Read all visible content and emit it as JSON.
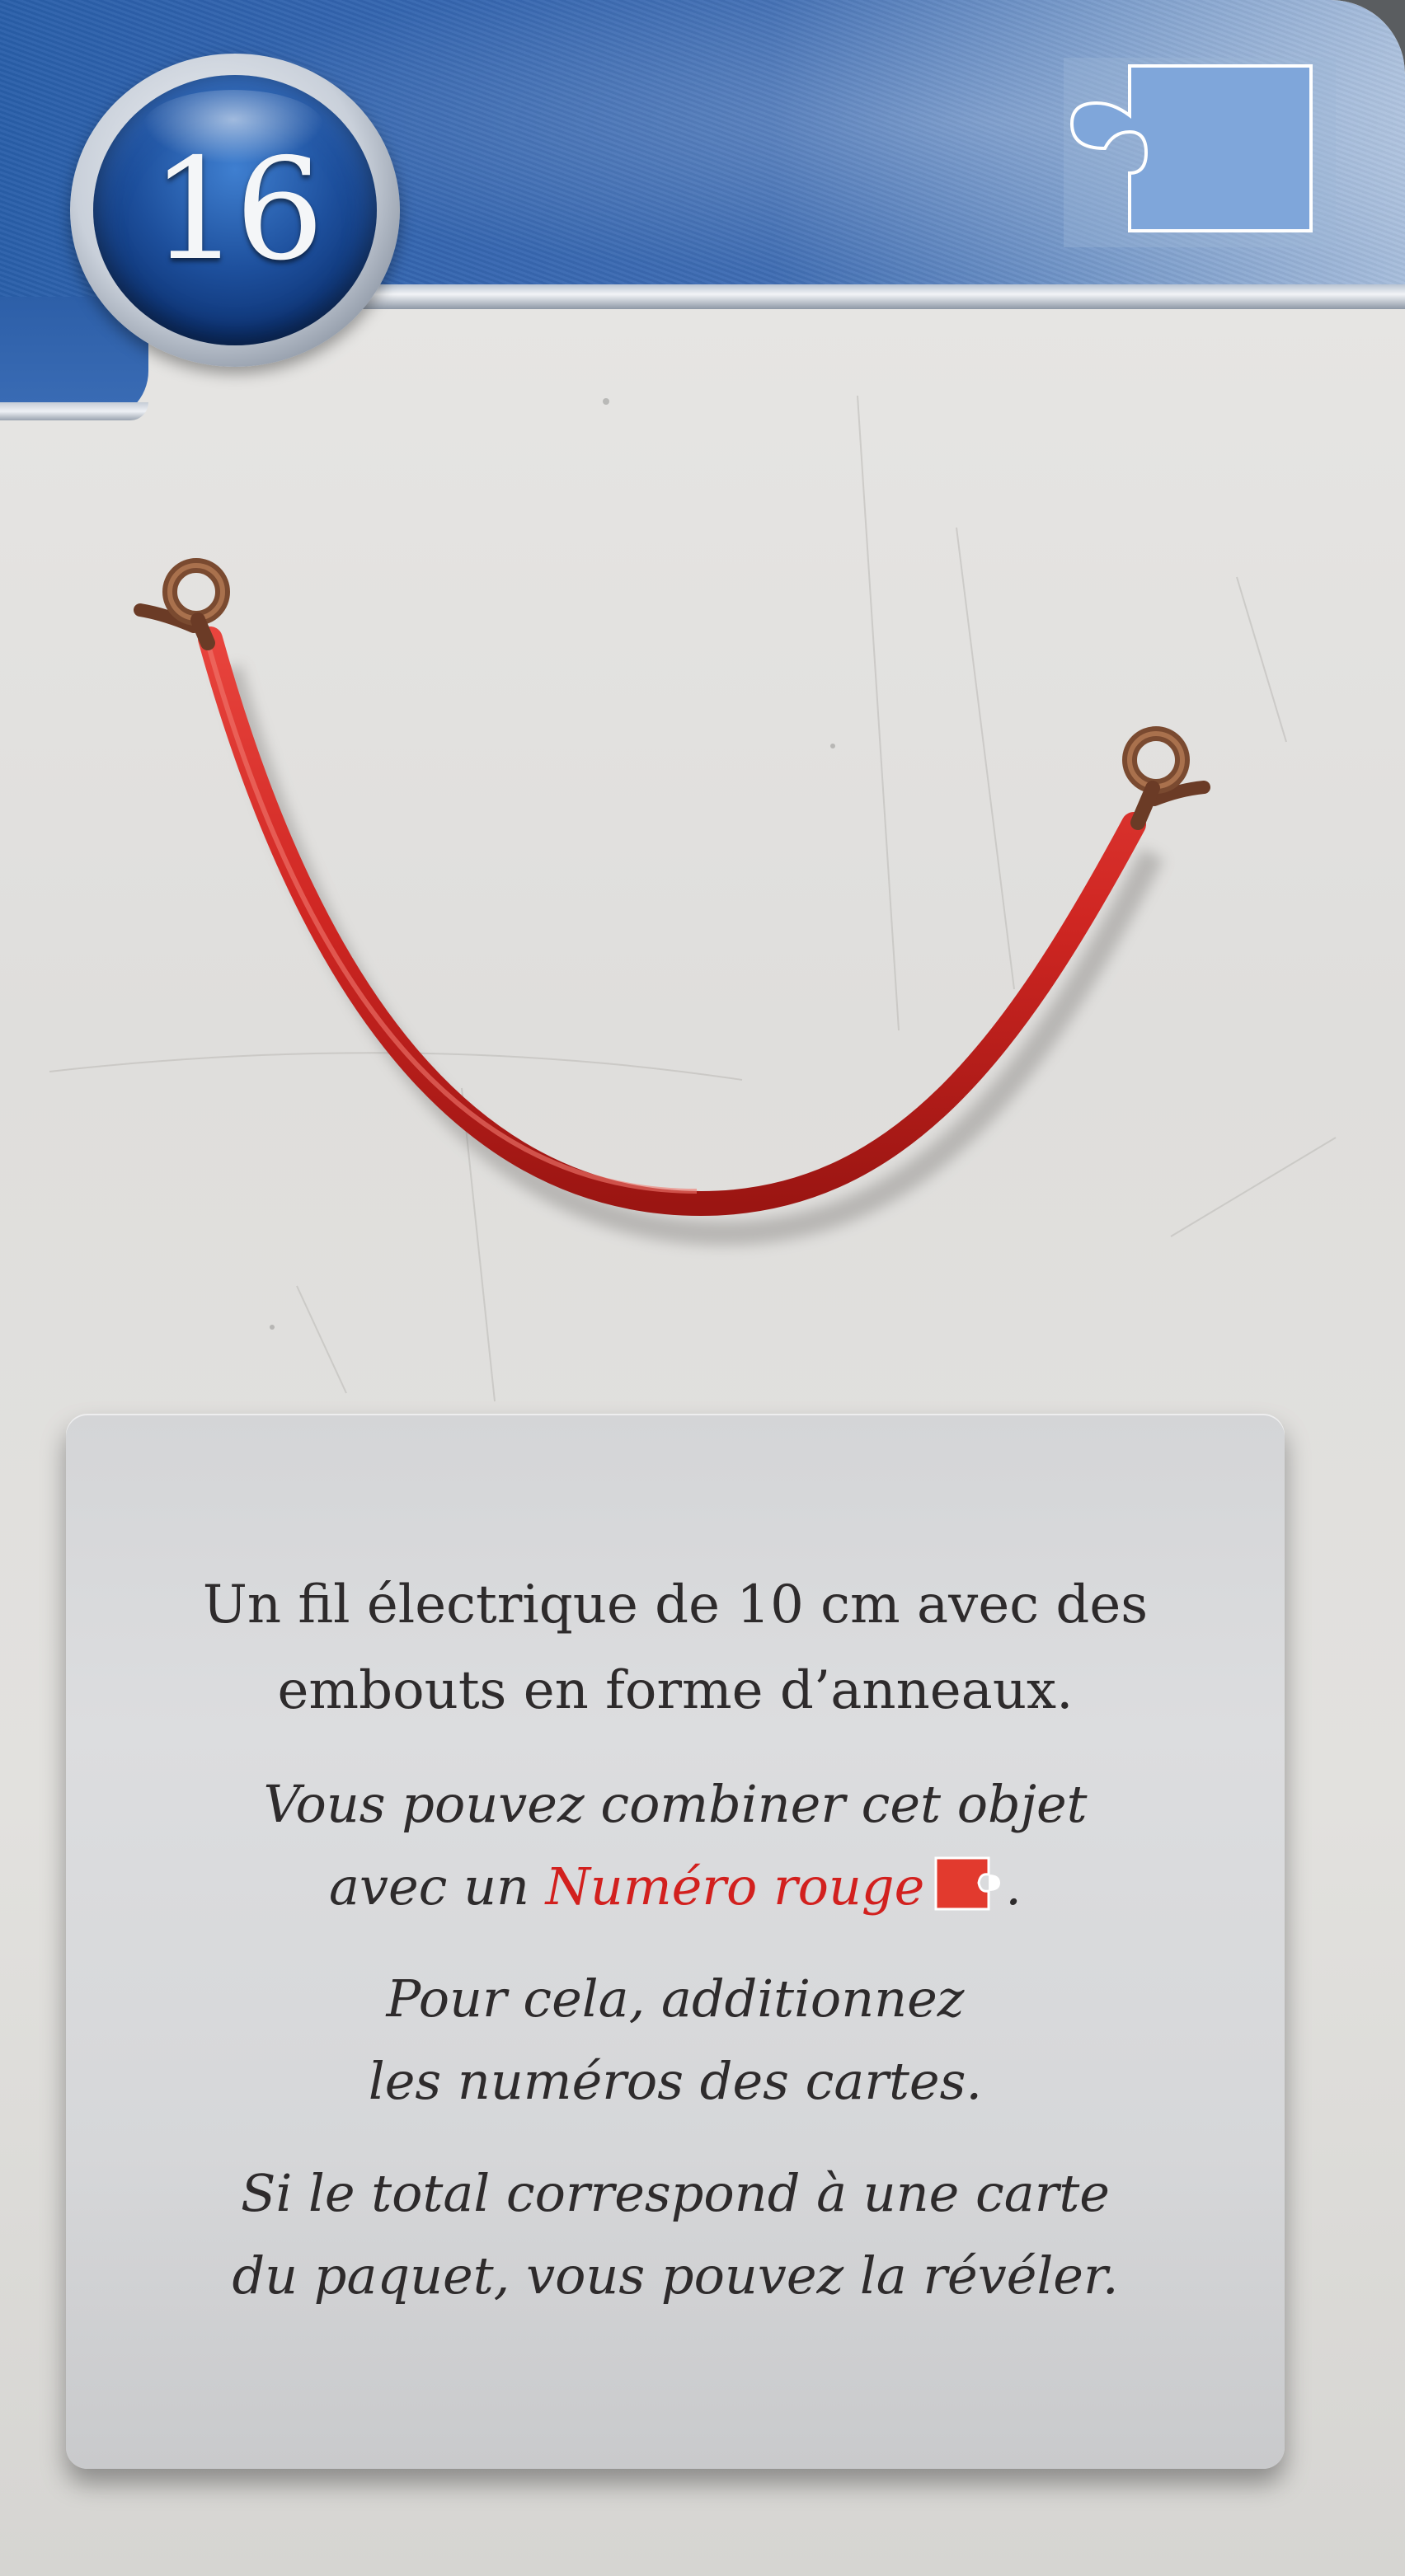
{
  "card": {
    "number": "16"
  },
  "icons": {
    "header_puzzle": "puzzle-piece-icon",
    "inline_puzzle": "red-puzzle-piece-icon"
  },
  "colors": {
    "header_blue": "#3566b0",
    "puzzle_blue": "#7fa6da",
    "wire_red": "#d62a26",
    "accent_red": "#d2201e"
  },
  "description": {
    "line1": "Un fil électrique de 10 cm avec des",
    "line2": "embouts en forme d’anneaux."
  },
  "combine": {
    "line1": "Vous pouvez combiner cet objet",
    "line2_prefix": "avec un ",
    "line2_highlight": "Numéro rouge",
    "line2_suffix": "."
  },
  "instruction": {
    "line1": "Pour cela, additionnez",
    "line2": "les numéros des cartes."
  },
  "reveal": {
    "line1": "Si le total correspond à une carte",
    "line2": "du paquet, vous pouvez la révéler."
  }
}
